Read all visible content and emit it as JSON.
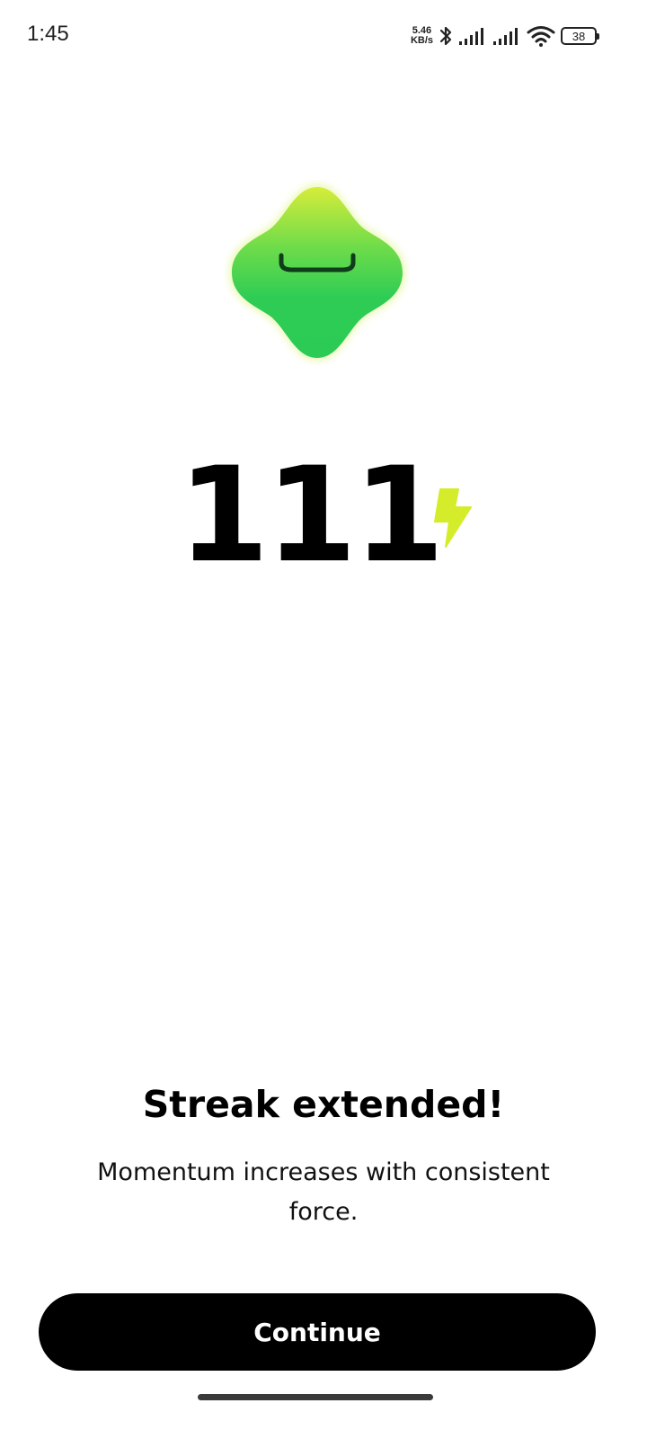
{
  "status_bar": {
    "time": "1:45",
    "net_speed_value": "5.46",
    "net_speed_unit": "KB/s",
    "battery": "38",
    "icons": [
      "bluetooth-icon",
      "signal-icon",
      "signal-icon",
      "wifi-icon",
      "battery-icon"
    ]
  },
  "mascot": {
    "icon": "smiling-green-blob-icon",
    "colors": {
      "top": "#d7ec3a",
      "body": "#2ecc55",
      "glow": "#eefac0",
      "mouth": "#0f3d1a"
    }
  },
  "streak": {
    "count": "111",
    "icon": "lightning-bolt-icon",
    "bolt_color": "#d4ec2a"
  },
  "message": {
    "title": "Streak extended!",
    "body": "Momentum increases with consistent force."
  },
  "actions": {
    "continue_label": "Continue"
  },
  "colors": {
    "background": "#ffffff",
    "button": "#000000",
    "button_text": "#ffffff"
  }
}
